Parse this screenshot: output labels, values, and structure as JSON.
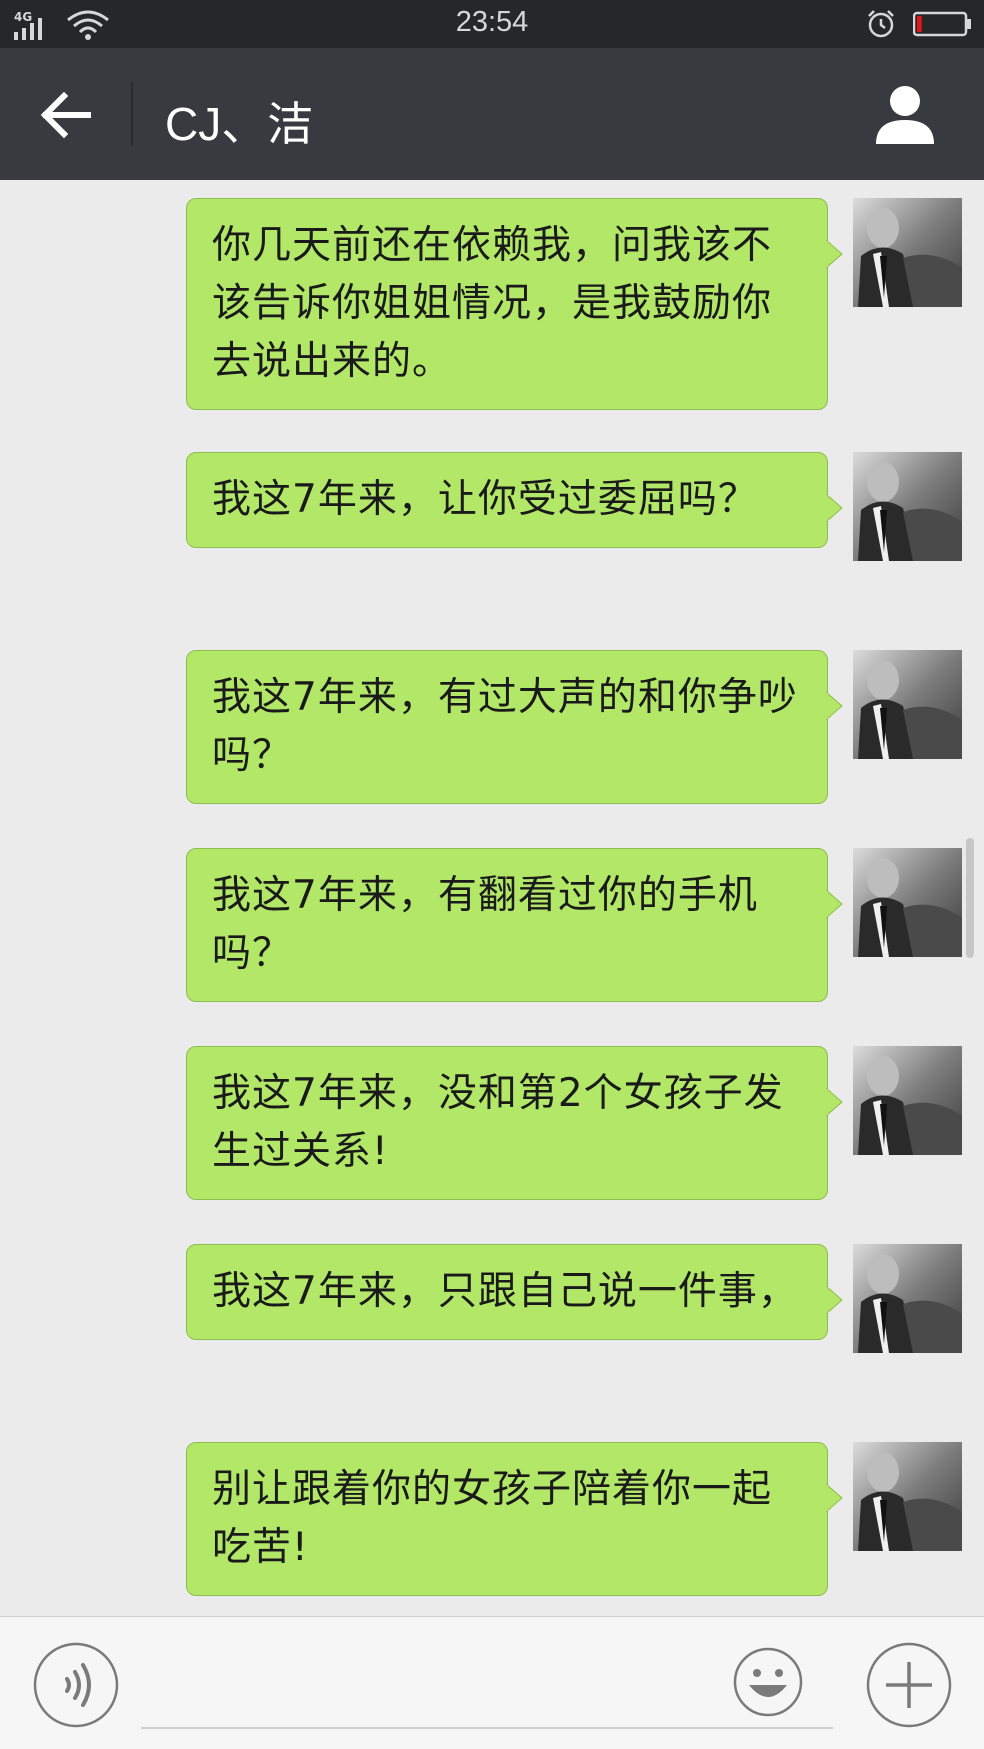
{
  "status_bar": {
    "network": "4G",
    "time": "23:54",
    "battery_level": 0.1,
    "battery_color": "#e8141c"
  },
  "header": {
    "title": "CJ、洁",
    "back_icon": "arrow-left-icon",
    "contact_icon": "person-icon"
  },
  "colors": {
    "bubble_bg": "#b2e768",
    "bubble_border": "#8ebd4f",
    "chat_bg": "#ebebeb",
    "title_bar_bg": "#393a3f",
    "status_bar_bg": "#262729"
  },
  "messages": [
    {
      "text": "你几天前还在依赖我，问我该不该告诉你姐姐情况，是我鼓励你去说出来的。"
    },
    {
      "text": "我这7年来，让你受过委屈吗？"
    },
    {
      "text": "我这7年来，有过大声的和你争吵吗？"
    },
    {
      "text": "我这7年来，有翻看过你的手机吗？"
    },
    {
      "text": "我这7年来，没和第2个女孩子发生过关系!"
    },
    {
      "text": "我这7年来，只跟自己说一件事，"
    },
    {
      "text": "别让跟着你的女孩子陪着你一起吃苦!"
    }
  ],
  "input_bar": {
    "voice_icon": "voice-icon",
    "emoji_icon": "smiley-icon",
    "plus_icon": "plus-icon",
    "input_value": ""
  }
}
